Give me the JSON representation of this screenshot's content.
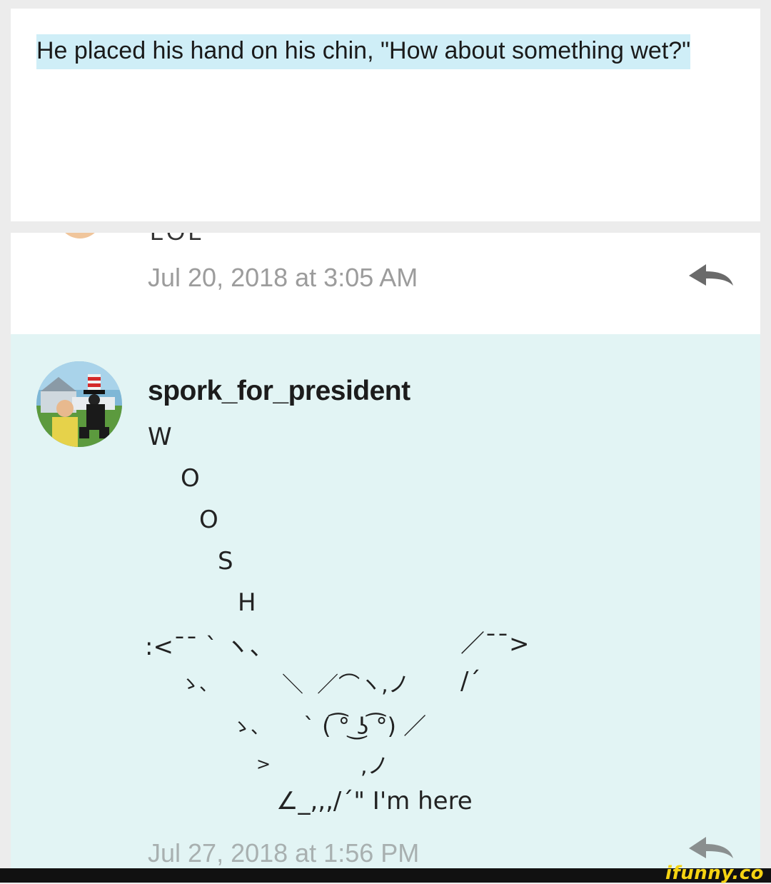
{
  "top_comment": {
    "text": "He placed his hand on his chin, \"How about something wet?\""
  },
  "mid_comment": {
    "cut_text": "LOL",
    "timestamp": "Jul 20, 2018 at 3:05 AM",
    "reply_icon": "reply-arrow-icon"
  },
  "reply": {
    "username": "spork_for_president",
    "ascii_lines": [
      "W",
      "O",
      "O",
      "S",
      "H",
      ":<¯¯ ` ヽ、",
      "ゝ、",
      "＼  ／⌒ヽ,ノ",
      "/´",
      "／¯¯>",
      "ゝ、",
      "` ( ͡° ͜ʖ ͡°) ／",
      ">",
      ",ノ",
      "∠_,,,/´\" I'm here"
    ],
    "timestamp": "Jul 27, 2018 at 1:56 PM",
    "reply_icon": "reply-arrow-icon"
  },
  "watermark": {
    "text": "ifunny.co"
  },
  "colors": {
    "highlight": "#cfeef7",
    "reply_background": "#e2f4f4",
    "timestamp": "#9c9c9c"
  }
}
